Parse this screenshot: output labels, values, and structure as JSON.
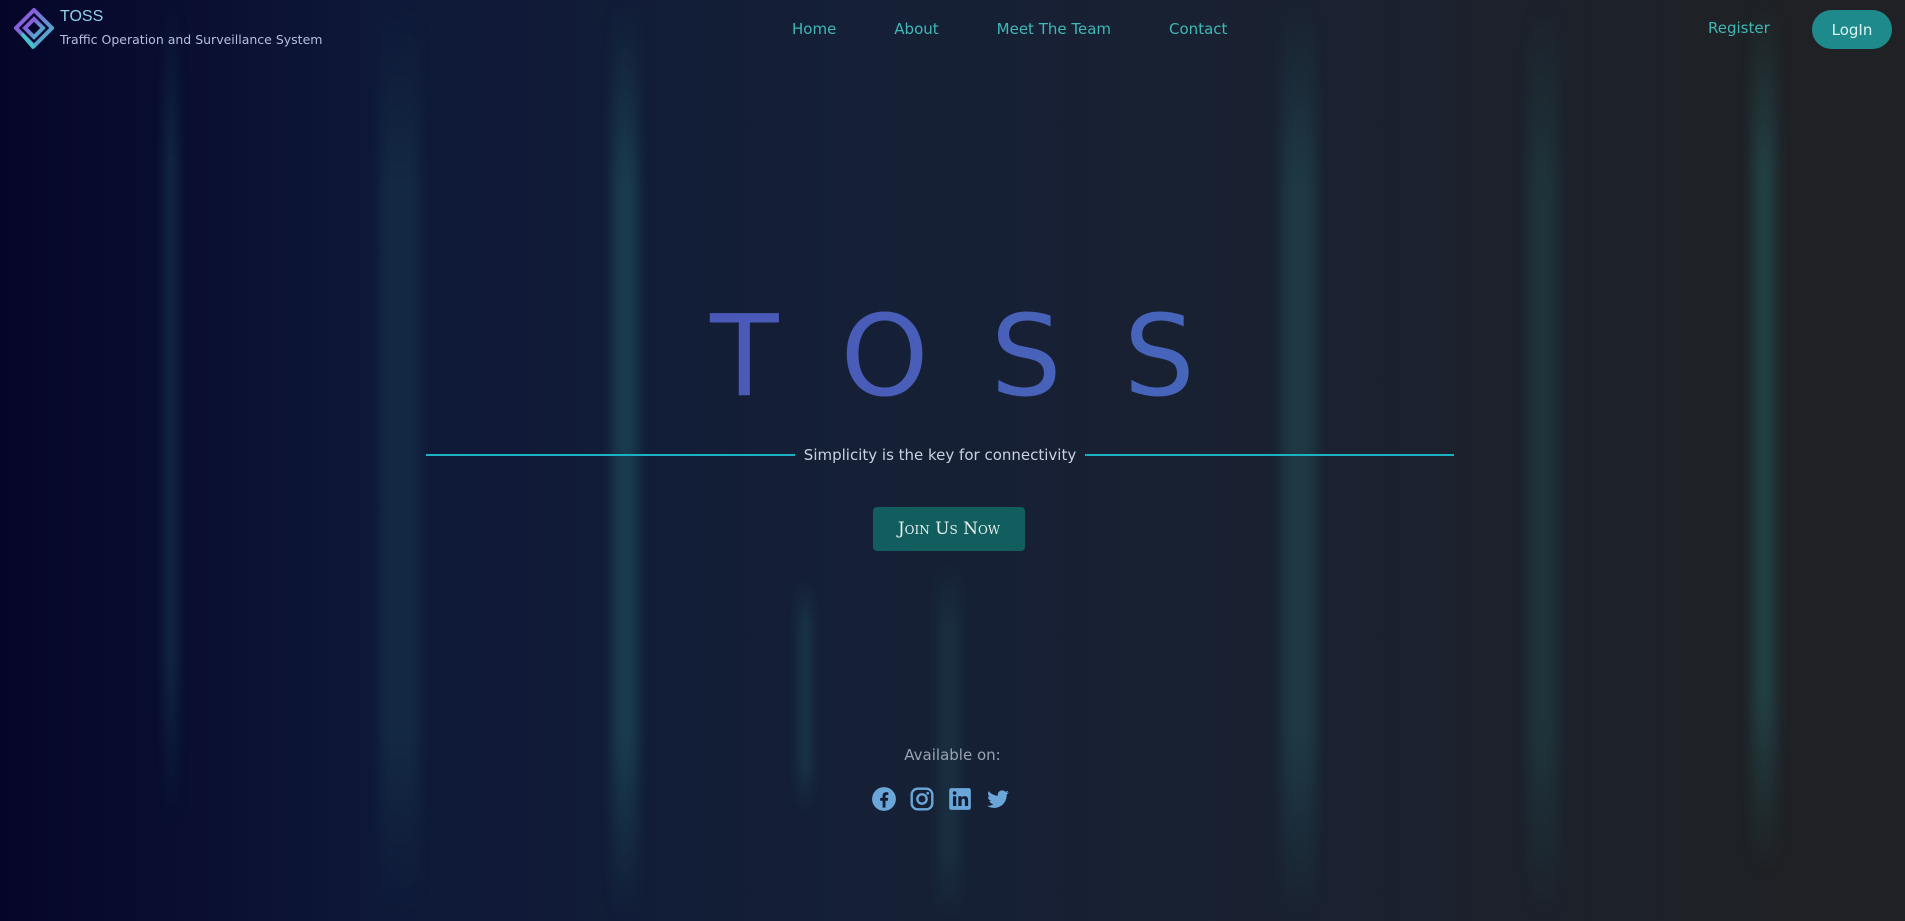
{
  "brand": {
    "name": "TOSS",
    "subtitle": "Traffic Operation and Surveillance System",
    "logo_icon": "toss-logo-icon"
  },
  "nav": {
    "items": [
      {
        "label": "Home"
      },
      {
        "label": "About"
      },
      {
        "label": "Meet The Team"
      },
      {
        "label": "Contact"
      }
    ],
    "register_label": "Register",
    "login_label": "LogIn"
  },
  "hero": {
    "title": "TOSS",
    "tagline": "Simplicity is the key for connectivity",
    "cta_label": "Join Us Now"
  },
  "footer": {
    "available_label": "Available on:",
    "socials": [
      {
        "name": "facebook-icon"
      },
      {
        "name": "instagram-icon"
      },
      {
        "name": "linkedin-icon"
      },
      {
        "name": "twitter-icon"
      }
    ]
  },
  "colors": {
    "accent": "#3fb8b6",
    "button": "#1f8a8c",
    "cta": "#125e5e",
    "tagline_line": "#1bb1c3",
    "social": "#6aa6d8"
  }
}
